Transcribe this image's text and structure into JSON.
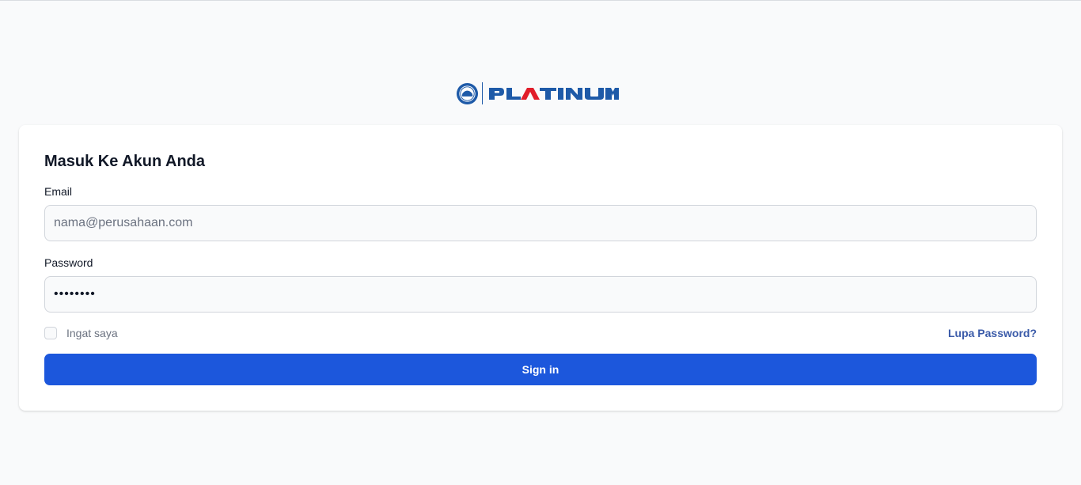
{
  "brand": {
    "name": "PLATINUM",
    "colors": {
      "primary_blue": "#1e5aa8",
      "accent_red": "#e11d2a"
    }
  },
  "login": {
    "title": "Masuk Ke Akun Anda",
    "email_label": "Email",
    "email_placeholder": "nama@perusahaan.com",
    "email_value": "",
    "password_label": "Password",
    "password_value": "••••••••",
    "remember_label": "Ingat saya",
    "remember_checked": false,
    "forgot_label": "Lupa Password?",
    "submit_label": "Sign in"
  },
  "theme": {
    "page_background": "#f9fafb",
    "card_background": "#ffffff",
    "button_color": "#1c57dc",
    "link_color": "#3b5ba9"
  }
}
